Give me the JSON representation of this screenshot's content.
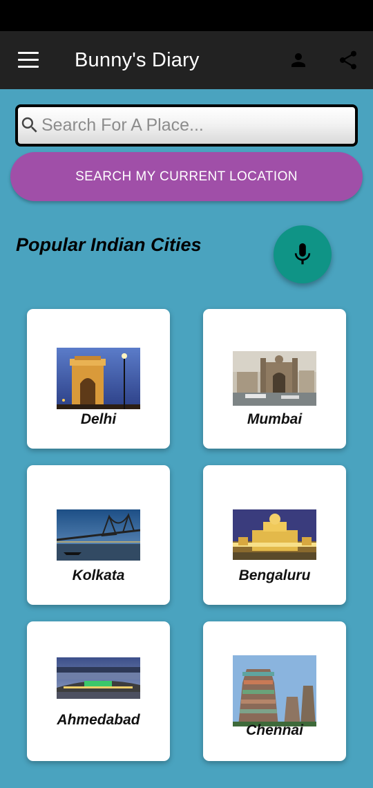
{
  "app_bar": {
    "title": "Bunny's Diary",
    "menu_icon": "hamburger-menu-icon",
    "profile_icon": "person-icon",
    "share_icon": "share-icon"
  },
  "search": {
    "placeholder": "Search For A Place...",
    "value": "",
    "icon": "search-icon"
  },
  "location_button": {
    "label": "SEARCH MY CURRENT LOCATION"
  },
  "popular": {
    "title": "Popular Indian Cities"
  },
  "mic_icon": "microphone-icon",
  "cities": [
    {
      "name": "Delhi"
    },
    {
      "name": "Mumbai"
    },
    {
      "name": "Kolkata"
    },
    {
      "name": "Bengaluru"
    },
    {
      "name": "Ahmedabad"
    },
    {
      "name": "Chennai"
    }
  ],
  "colors": {
    "background": "#4aa3bf",
    "app_bar": "#222222",
    "location_button": "#a04fa8",
    "fab": "#0f9486"
  }
}
